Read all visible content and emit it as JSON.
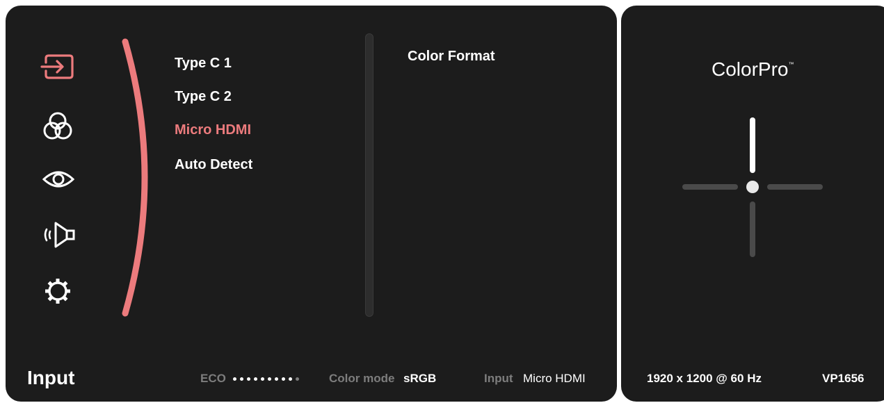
{
  "menu": {
    "icons": [
      {
        "name": "input-icon",
        "active": true
      },
      {
        "name": "color-adjust-icon",
        "active": false
      },
      {
        "name": "view-mode-icon",
        "active": false
      },
      {
        "name": "audio-icon",
        "active": false
      },
      {
        "name": "setup-icon",
        "active": false
      }
    ],
    "options": [
      {
        "label": "Type C 1",
        "selected": false
      },
      {
        "label": "Type C 2",
        "selected": false
      },
      {
        "label": "Micro HDMI",
        "selected": true
      },
      {
        "label": "Auto Detect",
        "selected": false
      }
    ],
    "submenu_label": "Color Format",
    "section_title": "Input"
  },
  "status": {
    "eco_label": "ECO",
    "eco_level": 0.9,
    "color_mode_label": "Color mode",
    "color_mode_value": "sRGB",
    "input_label": "Input",
    "input_value": "Micro HDMI"
  },
  "side_panel": {
    "brand": "ColorPro",
    "trademark": "™",
    "resolution": "1920 x 1200 @ 60 Hz",
    "model": "VP1656",
    "joystick_icon": "joystick-navigation-icon"
  },
  "colors": {
    "panel_bg": "#1c1c1c",
    "accent": "#ec7b7d",
    "text_primary": "#ffffff",
    "text_dim": "#7d7d7d"
  }
}
